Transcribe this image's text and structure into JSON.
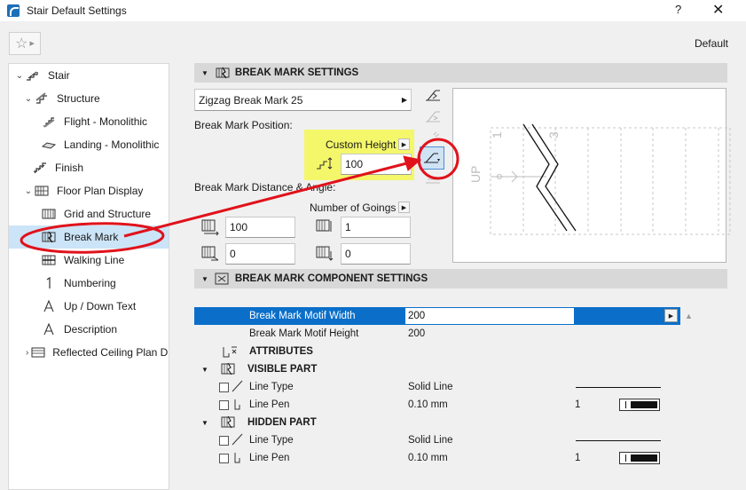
{
  "window": {
    "title": "Stair Default Settings",
    "help_label": "?",
    "close_label": "✕"
  },
  "toolbar": {
    "favorites_icon": "star-icon",
    "default_label": "Default"
  },
  "sidebar": {
    "items": [
      {
        "label": "Stair",
        "icon": "stair-icon",
        "expanded": true
      },
      {
        "label": "Structure",
        "icon": "structure-icon",
        "expanded": true
      },
      {
        "label": "Flight - Monolithic",
        "icon": "flight-icon"
      },
      {
        "label": "Landing - Monolithic",
        "icon": "landing-icon"
      },
      {
        "label": "Finish",
        "icon": "finish-icon"
      },
      {
        "label": "Floor Plan Display",
        "icon": "floor-plan-icon",
        "expanded": true
      },
      {
        "label": "Grid and Structure",
        "icon": "grid-icon"
      },
      {
        "label": "Break Mark",
        "icon": "break-mark-icon",
        "selected": true
      },
      {
        "label": "Walking Line",
        "icon": "walking-line-icon"
      },
      {
        "label": "Numbering",
        "icon": "numbering-icon"
      },
      {
        "label": "Up / Down Text",
        "icon": "text-a-icon"
      },
      {
        "label": "Description",
        "icon": "text-a-icon"
      },
      {
        "label": "Reflected Ceiling Plan Di",
        "icon": "ceiling-plan-icon",
        "expanded": false
      }
    ]
  },
  "break_mark_settings": {
    "section_title": "BREAK MARK SETTINGS",
    "type_value": "Zigzag Break Mark 25",
    "position_label": "Break Mark Position:",
    "custom_height_label": "Custom Height",
    "custom_height_value": "100",
    "distance_angle_label": "Break Mark Distance & Angle:",
    "number_of_goings_label": "Number of Goings",
    "distance_value": "100",
    "angle_value": "0",
    "goings_value": "1",
    "goings_offset_value": "0"
  },
  "preview": {
    "up_text": "UP",
    "step_numbers": [
      "1",
      "3"
    ]
  },
  "component_settings": {
    "section_title": "BREAK MARK COMPONENT SETTINGS",
    "rows": [
      {
        "name": "Break Mark Motif Width",
        "value": "200",
        "selected": true
      },
      {
        "name": "Break Mark Motif Height",
        "value": "200"
      }
    ],
    "attributes_label": "ATTRIBUTES",
    "visible_part": {
      "title": "VISIBLE PART",
      "line_type_label": "Line Type",
      "line_type_value": "Solid Line",
      "line_pen_label": "Line Pen",
      "line_pen_value": "0.10 mm",
      "pen_number": "1"
    },
    "hidden_part": {
      "title": "HIDDEN PART",
      "line_type_label": "Line Type",
      "line_type_value": "Solid Line",
      "line_pen_label": "Line Pen",
      "line_pen_value": "0.10 mm",
      "pen_number": "1"
    }
  },
  "colors": {
    "selection_blue": "#0b6fc9",
    "tree_selection": "#cce4f7",
    "highlight_yellow": "#f4f76a",
    "annotation_red": "#e0121b"
  }
}
